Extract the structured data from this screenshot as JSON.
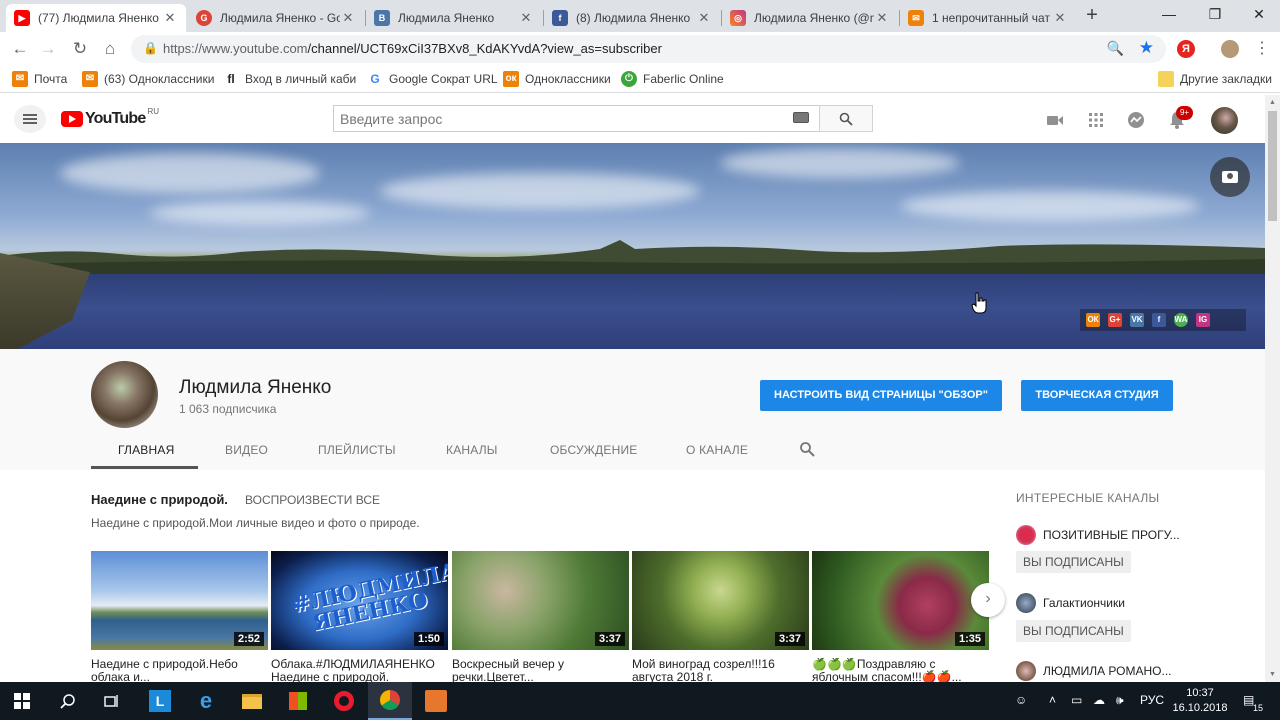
{
  "browser": {
    "tabs": [
      {
        "title": "(77) Людмила Яненко",
        "active": true,
        "fav_color": "#ff0000"
      },
      {
        "title": "Людмила Яненко - Go",
        "active": false,
        "fav_color": "#db4437"
      },
      {
        "title": "Людмила Яненко",
        "active": false,
        "fav_color": "#4a76a8"
      },
      {
        "title": "(8) Людмила Яненко",
        "active": false,
        "fav_color": "#3b5998"
      },
      {
        "title": "Людмила Яненко (@m",
        "active": false,
        "fav_color": "#c13584"
      },
      {
        "title": "1 непрочитанный чат",
        "active": false,
        "fav_color": "#ee8208"
      }
    ],
    "url_host": "https://www.youtube.com",
    "url_path": "/channel/UCT69xCiI37BXv8_KdAKYvdA?view_as=subscriber",
    "bookmarks": [
      {
        "label": "Почта",
        "color": "#ee8208"
      },
      {
        "label": "(63) Одноклассники",
        "color": "#ee8208"
      },
      {
        "label": "Вход в личный каби",
        "color": "#222222"
      },
      {
        "label": "Google Сократ URL",
        "color": "#4285f4"
      },
      {
        "label": "Одноклассники",
        "color": "#ee8208"
      },
      {
        "label": "Faberlic Online",
        "color": "#3aa53a"
      }
    ],
    "other_bookmarks": "Другие закладки"
  },
  "youtube": {
    "logo_text": "YouTube",
    "logo_region": "RU",
    "search_placeholder": "Введите запрос",
    "notifications_badge": "9+",
    "social_labels": [
      "ОК",
      "G+",
      "VK",
      "f",
      "WA",
      "IG"
    ]
  },
  "channel": {
    "name": "Людмила Яненко",
    "subscribers": "1 063 подписчика",
    "customize_button": "НАСТРОИТЬ ВИД СТРАНИЦЫ \"ОБЗОР\"",
    "studio_button": "ТВОРЧЕСКАЯ СТУДИЯ",
    "tabs": [
      "ГЛАВНАЯ",
      "ВИДЕО",
      "ПЛЕЙЛИСТЫ",
      "КАНАЛЫ",
      "ОБСУЖДЕНИЕ",
      "О КАНАЛЕ"
    ]
  },
  "section": {
    "title": "Наедине с природой.",
    "play_all": "ВОСПРОИЗВЕСТИ ВСЕ",
    "description": "Наедине с природой.Мои личные видео и фото о природе."
  },
  "videos": [
    {
      "title": "Наедине с природой.Небо облака и...",
      "duration": "2:52"
    },
    {
      "title": "Облака.#ЛЮДМИЛАЯНЕНКО Наедине с природой.",
      "duration": "1:50",
      "overlay": "#ЛЮДМИЛА ЯНЕНКО"
    },
    {
      "title": "Воскресный вечер у речки.Цветет...",
      "duration": "3:37"
    },
    {
      "title": "Мой виноград созрел!!!16 августа 2018 г.",
      "duration": "3:37"
    },
    {
      "title": "🍏🍏🍏Поздравляю с яблочным спасом!!!🍎🍎...",
      "duration": "1:35"
    }
  ],
  "sidebar": {
    "header": "ИНТЕРЕСНЫЕ КАНАЛЫ",
    "channels": [
      {
        "name": "ПОЗИТИВНЫЕ ПРОГУ...",
        "button": "ВЫ ПОДПИСАНЫ"
      },
      {
        "name": "Галактиончики",
        "button": "ВЫ ПОДПИСАНЫ"
      },
      {
        "name": "ЛЮДМИЛА РОМАНО...",
        "button": ""
      }
    ]
  },
  "taskbar": {
    "language": "РУС",
    "time": "10:37",
    "date": "16.10.2018",
    "notifications": "15"
  }
}
